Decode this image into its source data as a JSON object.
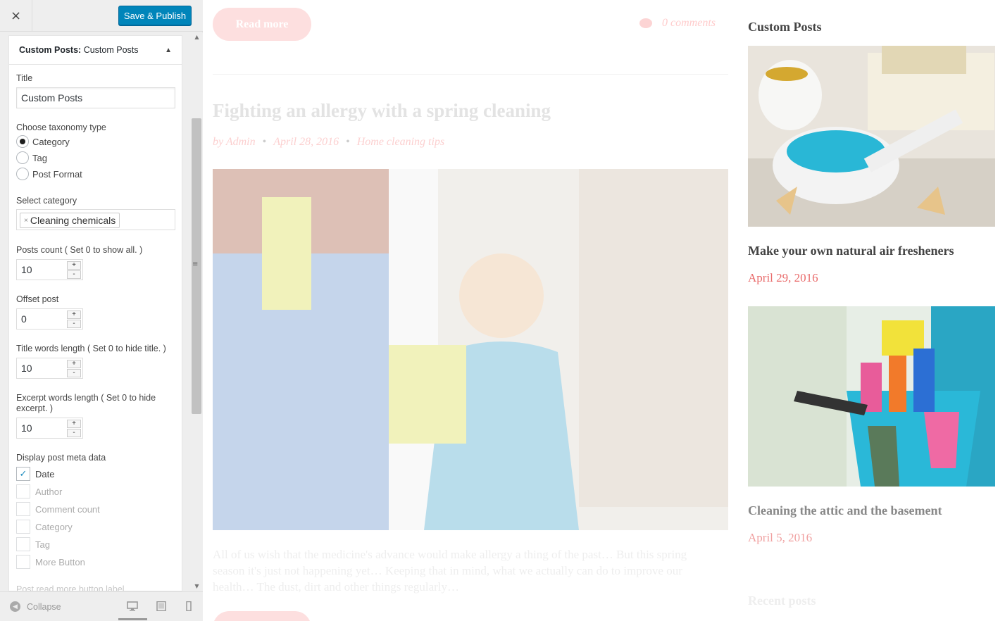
{
  "header": {
    "close_label": "×",
    "publish_label": "Save & Publish"
  },
  "widget": {
    "title_prefix": "Custom Posts:",
    "title_name": "Custom Posts",
    "toggle": "▲",
    "title_label": "Title",
    "title_value": "Custom Posts",
    "taxonomy_label": "Choose taxonomy type",
    "taxonomy_options": [
      "Category",
      "Tag",
      "Post Format"
    ],
    "taxonomy_selected": "Category",
    "category_label": "Select category",
    "category_tag": "Cleaning chemicals",
    "category_tag_remove": "×",
    "posts_count_label": "Posts count ( Set 0 to show all. )",
    "posts_count_value": "10",
    "offset_label": "Offset post",
    "offset_value": "0",
    "title_words_label": "Title words length ( Set 0 to hide title. )",
    "title_words_value": "10",
    "excerpt_label_line1": "Excerpt words length ( Set 0 to hide",
    "excerpt_label_line2": "excerpt. )",
    "excerpt_value": "10",
    "meta_label": "Display post meta data",
    "meta_items": [
      {
        "label": "Date",
        "checked": true
      },
      {
        "label": "Author",
        "checked": false
      },
      {
        "label": "Comment count",
        "checked": false
      },
      {
        "label": "Category",
        "checked": false
      },
      {
        "label": "Tag",
        "checked": false
      },
      {
        "label": "More Button",
        "checked": false
      }
    ],
    "cut_label": "Post read more button label",
    "stepper_up": "+",
    "stepper_down": "-"
  },
  "footer": {
    "collapse_label": "Collapse"
  },
  "preview": {
    "read_more_label": "Read more",
    "comments": "0 comments",
    "post_title": "Fighting an allergy with a spring cleaning",
    "post_author": "by Admin",
    "post_date": "April 28, 2016",
    "post_category": "Home cleaning tips",
    "post_excerpt": "All of us wish that the medicine's advance would make allergy a thing of the past… But this spring season it's just not happening yet… Keeping that in mind, what we actually can do to improve our health… The dust, dirt and other things regularly…"
  },
  "sidebar": {
    "title": "Custom Posts",
    "posts": [
      {
        "title": "Make your own natural air fresheners",
        "date": "April 29, 2016"
      },
      {
        "title": "Cleaning the attic and the basement",
        "date": "April 5, 2016"
      }
    ],
    "recent_title": "Recent posts"
  },
  "colors": {
    "accent": "#0085ba",
    "date": "#e96b6b",
    "read_more": "#fddfdf"
  }
}
